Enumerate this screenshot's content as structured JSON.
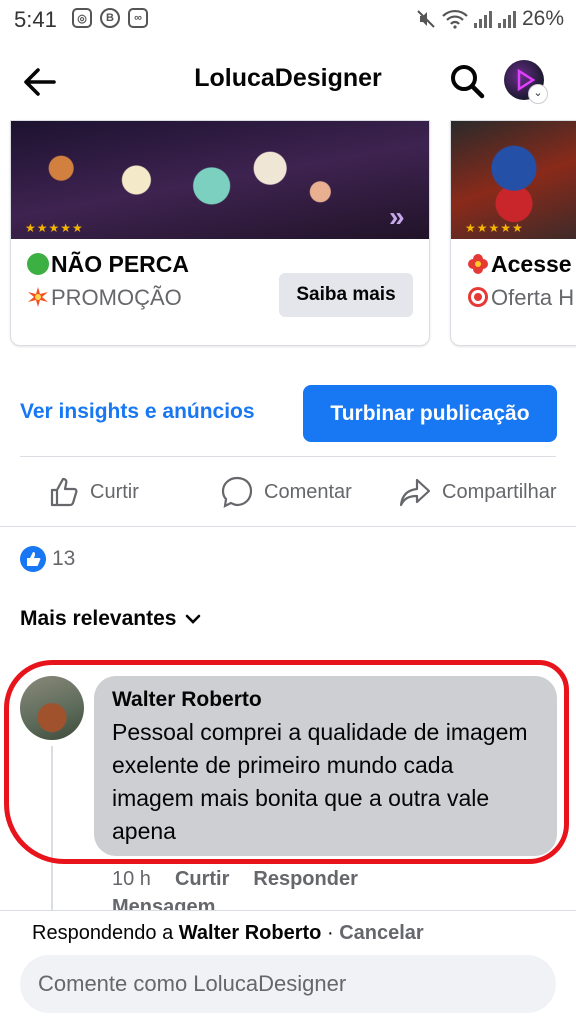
{
  "status_bar": {
    "time": "5:41",
    "battery": "26%"
  },
  "header": {
    "title": "LolucaDesigner"
  },
  "cards": [
    {
      "line1": "NÃO PERCA",
      "line2": "PROMOÇÃO",
      "button": "Saiba mais",
      "stars": "★★★★★"
    },
    {
      "line1": "Acesse",
      "line2": "Oferta H",
      "stars": "★★★★★"
    }
  ],
  "insights": {
    "link": "Ver insights e anúncios",
    "boost": "Turbinar publicação"
  },
  "actions": {
    "like": "Curtir",
    "comment": "Comentar",
    "share": "Compartilhar"
  },
  "reactions": {
    "count": "13"
  },
  "sort": {
    "label": "Mais relevantes"
  },
  "comment": {
    "author": "Walter Roberto",
    "text": "Pessoal comprei a qualidade de imagem exelente de primeiro mundo cada imagem mais bonita que a outra vale apena",
    "time": "10 h",
    "like": "Curtir",
    "reply": "Responder",
    "more": "Mensagem"
  },
  "composer": {
    "replying_prefix": "Respondendo a",
    "replying_name": "Walter Roberto",
    "separator": " · ",
    "cancel": "Cancelar",
    "placeholder": "Comente como LolucaDesigner"
  },
  "colors": {
    "accent": "#1877f2",
    "annotation": "#e8141c",
    "bubble": "#cdcfd2"
  }
}
